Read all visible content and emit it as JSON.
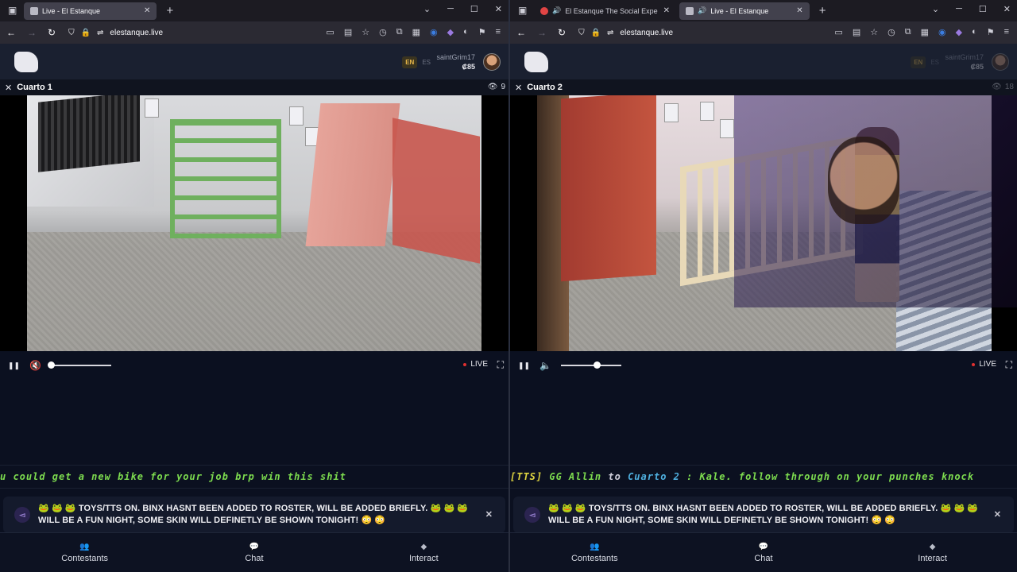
{
  "windows": [
    {
      "tabs": [
        {
          "label": "Live - El Estanque",
          "active": true
        }
      ],
      "url": "elestanque.live",
      "user": {
        "name": "saintGrim17",
        "coins": "₡85"
      },
      "lang": {
        "en": "EN",
        "es": "ES"
      },
      "room": {
        "title": "Cuarto 1",
        "viewers": "9"
      },
      "player": {
        "live": "LIVE",
        "muted": true,
        "volume_pct": 0
      },
      "ticker": {
        "text": "u could get a new bike for your job brp win this shit"
      },
      "announcement": {
        "text": "🐸 🐸 🐸 TOYS/TTS ON. BINX HASNT BEEN ADDED TO ROSTER, WILL BE ADDED BRIEFLY. 🐸 🐸 🐸 WILL BE A FUN NIGHT, SOME SKIN WILL DEFINETLY BE SHOWN TONIGHT! 😳 😳"
      },
      "nav": {
        "contestants": "Contestants",
        "chat": "Chat",
        "interact": "Interact"
      }
    },
    {
      "tabs": [
        {
          "label": "El Estanque The Social Expe",
          "active": false
        },
        {
          "label": "Live - El Estanque",
          "active": true
        }
      ],
      "url": "elestanque.live",
      "user": {
        "name": "saintGrim17",
        "coins": "₡85"
      },
      "lang": {
        "en": "EN",
        "es": "ES"
      },
      "room": {
        "title": "Cuarto 2",
        "viewers": "18"
      },
      "player": {
        "live": "LIVE",
        "muted": false,
        "volume_pct": 60
      },
      "ticker": {
        "tts": "[TTS]",
        "who": "GG Allin",
        "to": "to",
        "room": "Cuarto 2",
        "text": ": Kale. follow through on your punches knock"
      },
      "announcement": {
        "text": "🐸 🐸 🐸 TOYS/TTS ON. BINX HASNT BEEN ADDED TO ROSTER, WILL BE ADDED BRIEFLY. 🐸 🐸 🐸 WILL BE A FUN NIGHT, SOME SKIN WILL DEFINETLY BE SHOWN TONIGHT! 😳 😳"
      },
      "nav": {
        "contestants": "Contestants",
        "chat": "Chat",
        "interact": "Interact"
      }
    }
  ],
  "icons": {
    "close": "✕",
    "back": "←",
    "forward": "→",
    "reload": "↻",
    "pause": "❚❚",
    "speaker": "🔈",
    "eye": "👁",
    "fullscreen": "⛶",
    "minimize": "─",
    "maximize": "☐",
    "plus": "+",
    "chevron": "⌄",
    "menu": "≡"
  },
  "colors": {
    "accent_live": "#e03030",
    "ticker_green": "#7ddc4f",
    "en_badge": "#e8b84a"
  }
}
